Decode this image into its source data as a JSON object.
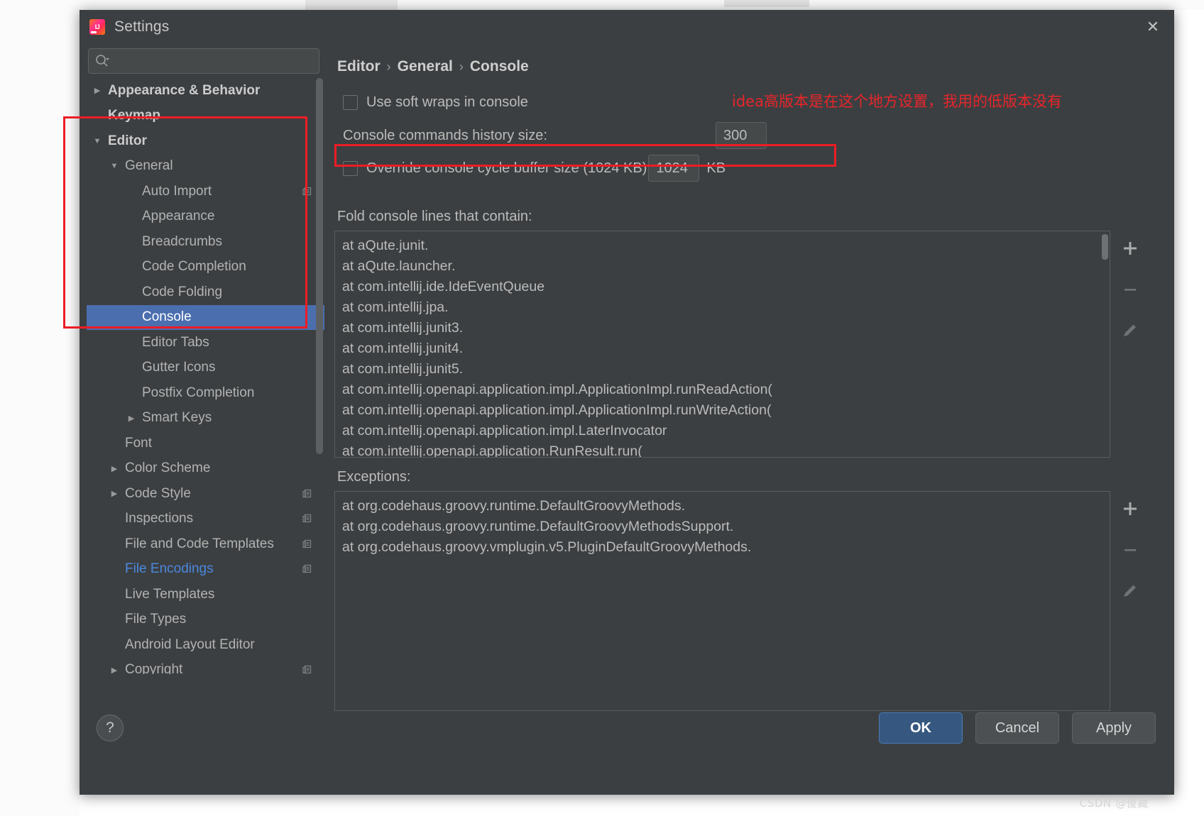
{
  "window": {
    "title": "Settings",
    "logo_icon": "intellij-idea-logo",
    "close_icon": "close-icon"
  },
  "search": {
    "placeholder": "",
    "value": "",
    "icon": "search-icon",
    "dropdown_icon": "chevron-down-icon"
  },
  "sidebar": {
    "scrollbar": "vertical-scrollbar",
    "items": [
      {
        "label": "Appearance & Behavior",
        "arrow": "collapsed",
        "indent": 0,
        "bold": true,
        "selected": false,
        "link": false,
        "badge": false
      },
      {
        "label": "Keymap",
        "arrow": "none",
        "indent": 0,
        "bold": true,
        "selected": false,
        "link": false,
        "badge": false
      },
      {
        "label": "Editor",
        "arrow": "expanded",
        "indent": 0,
        "bold": true,
        "selected": false,
        "link": false,
        "badge": false
      },
      {
        "label": "General",
        "arrow": "expanded",
        "indent": 1,
        "bold": false,
        "selected": false,
        "link": false,
        "badge": false
      },
      {
        "label": "Auto Import",
        "arrow": "none",
        "indent": 2,
        "bold": false,
        "selected": false,
        "link": false,
        "badge": true
      },
      {
        "label": "Appearance",
        "arrow": "none",
        "indent": 2,
        "bold": false,
        "selected": false,
        "link": false,
        "badge": false
      },
      {
        "label": "Breadcrumbs",
        "arrow": "none",
        "indent": 2,
        "bold": false,
        "selected": false,
        "link": false,
        "badge": false
      },
      {
        "label": "Code Completion",
        "arrow": "none",
        "indent": 2,
        "bold": false,
        "selected": false,
        "link": false,
        "badge": false
      },
      {
        "label": "Code Folding",
        "arrow": "none",
        "indent": 2,
        "bold": false,
        "selected": false,
        "link": false,
        "badge": false
      },
      {
        "label": "Console",
        "arrow": "none",
        "indent": 2,
        "bold": false,
        "selected": true,
        "link": false,
        "badge": false
      },
      {
        "label": "Editor Tabs",
        "arrow": "none",
        "indent": 2,
        "bold": false,
        "selected": false,
        "link": false,
        "badge": false
      },
      {
        "label": "Gutter Icons",
        "arrow": "none",
        "indent": 2,
        "bold": false,
        "selected": false,
        "link": false,
        "badge": false
      },
      {
        "label": "Postfix Completion",
        "arrow": "none",
        "indent": 2,
        "bold": false,
        "selected": false,
        "link": false,
        "badge": false
      },
      {
        "label": "Smart Keys",
        "arrow": "collapsed",
        "indent": 2,
        "bold": false,
        "selected": false,
        "link": false,
        "badge": false
      },
      {
        "label": "Font",
        "arrow": "none",
        "indent": 1,
        "bold": false,
        "selected": false,
        "link": false,
        "badge": false
      },
      {
        "label": "Color Scheme",
        "arrow": "collapsed",
        "indent": 1,
        "bold": false,
        "selected": false,
        "link": false,
        "badge": false
      },
      {
        "label": "Code Style",
        "arrow": "collapsed",
        "indent": 1,
        "bold": false,
        "selected": false,
        "link": false,
        "badge": true
      },
      {
        "label": "Inspections",
        "arrow": "none",
        "indent": 1,
        "bold": false,
        "selected": false,
        "link": false,
        "badge": true
      },
      {
        "label": "File and Code Templates",
        "arrow": "none",
        "indent": 1,
        "bold": false,
        "selected": false,
        "link": false,
        "badge": true
      },
      {
        "label": "File Encodings",
        "arrow": "none",
        "indent": 1,
        "bold": false,
        "selected": false,
        "link": true,
        "badge": true
      },
      {
        "label": "Live Templates",
        "arrow": "none",
        "indent": 1,
        "bold": false,
        "selected": false,
        "link": false,
        "badge": false
      },
      {
        "label": "File Types",
        "arrow": "none",
        "indent": 1,
        "bold": false,
        "selected": false,
        "link": false,
        "badge": false
      },
      {
        "label": "Android Layout Editor",
        "arrow": "none",
        "indent": 1,
        "bold": false,
        "selected": false,
        "link": false,
        "badge": false
      },
      {
        "label": "Copyright",
        "arrow": "collapsed",
        "indent": 1,
        "bold": false,
        "selected": false,
        "link": false,
        "badge": true
      }
    ]
  },
  "main": {
    "breadcrumb": [
      "Editor",
      "General",
      "Console"
    ],
    "breadcrumb_separator": "›",
    "soft_wraps": {
      "label": "Use soft wraps in console",
      "checked": false
    },
    "history_size": {
      "label": "Console commands history size:",
      "value": "300"
    },
    "cycle_buffer": {
      "label": "Override console cycle buffer size (1024 KB)",
      "checked": false,
      "value": "1024",
      "unit": "KB"
    },
    "fold_section": {
      "title": "Fold console lines that contain:",
      "lines": [
        "at aQute.junit.",
        "at aQute.launcher.",
        "at com.intellij.ide.IdeEventQueue",
        "at com.intellij.jpa.",
        "at com.intellij.junit3.",
        "at com.intellij.junit4.",
        "at com.intellij.junit5.",
        "at com.intellij.openapi.application.impl.ApplicationImpl.runReadAction(",
        "at com.intellij.openapi.application.impl.ApplicationImpl.runWriteAction(",
        "at com.intellij.openapi.application.impl.LaterInvocator",
        "at com.intellij.openapi.application.RunResult.run("
      ],
      "tools": [
        {
          "name": "add-button",
          "glyph": "+"
        },
        {
          "name": "remove-button",
          "glyph": "−"
        },
        {
          "name": "edit-button",
          "glyph": "pencil"
        }
      ]
    },
    "exceptions_section": {
      "title": "Exceptions:",
      "lines": [
        "at org.codehaus.groovy.runtime.DefaultGroovyMethods.",
        "at org.codehaus.groovy.runtime.DefaultGroovyMethodsSupport.",
        "at org.codehaus.groovy.vmplugin.v5.PluginDefaultGroovyMethods."
      ],
      "tools": [
        {
          "name": "add-button",
          "glyph": "+"
        },
        {
          "name": "remove-button",
          "glyph": "−"
        },
        {
          "name": "edit-button",
          "glyph": "pencil"
        }
      ]
    }
  },
  "footer": {
    "help_label": "?",
    "ok_label": "OK",
    "cancel_label": "Cancel",
    "apply_label": "Apply"
  },
  "annotations": {
    "note_text": "idea高版本是在这个地方设置，我用的低版本没有",
    "color": "#ee1c25"
  },
  "watermark": {
    "text": "CSDN @傻藏"
  }
}
